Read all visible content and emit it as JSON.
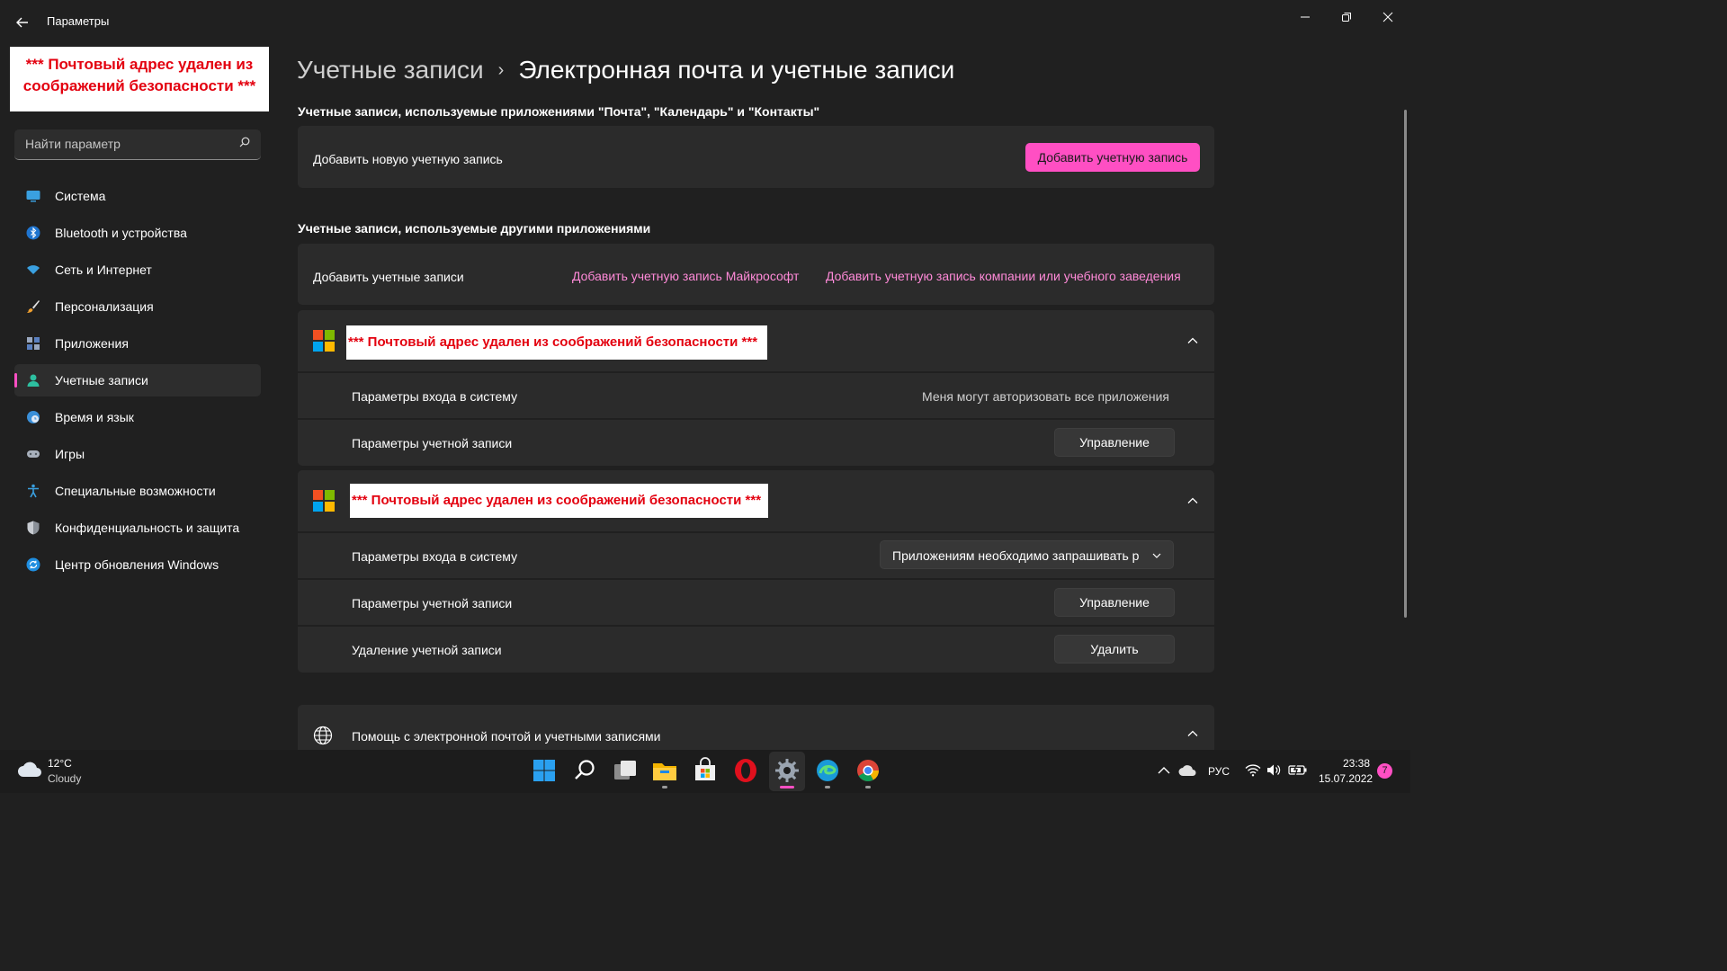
{
  "window": {
    "title": "Параметры"
  },
  "redaction": {
    "sidebar_text": "*** Почтовый адрес удален из соображений безопасности ***",
    "account_text": "*** Почтовый адрес удален из соображений безопасности ***"
  },
  "search": {
    "placeholder": "Найти параметр"
  },
  "sidebar": {
    "items": [
      {
        "label": "Система",
        "icon": "monitor-icon"
      },
      {
        "label": "Bluetooth и устройства",
        "icon": "bluetooth-icon"
      },
      {
        "label": "Сеть и Интернет",
        "icon": "wifi-icon"
      },
      {
        "label": "Персонализация",
        "icon": "brush-icon"
      },
      {
        "label": "Приложения",
        "icon": "apps-icon"
      },
      {
        "label": "Учетные записи",
        "icon": "person-icon",
        "active": true
      },
      {
        "label": "Время и язык",
        "icon": "globe-clock-icon"
      },
      {
        "label": "Игры",
        "icon": "gamepad-icon"
      },
      {
        "label": "Специальные возможности",
        "icon": "accessibility-icon"
      },
      {
        "label": "Конфиденциальность и защита",
        "icon": "shield-icon"
      },
      {
        "label": "Центр обновления Windows",
        "icon": "update-icon"
      }
    ]
  },
  "breadcrumb": {
    "parent": "Учетные записи",
    "separator": "›",
    "current": "Электронная почта и учетные записи"
  },
  "section_mail": {
    "title": "Учетные записи, используемые приложениями \"Почта\", \"Календарь\" и \"Контакты\"",
    "add_row_label": "Добавить новую учетную запись",
    "add_button": "Добавить учетную запись"
  },
  "section_other": {
    "title": "Учетные записи, используемые другими приложениями",
    "add_row_label": "Добавить учетные записи",
    "link_microsoft": "Добавить учетную запись Майкрософт",
    "link_work": "Добавить учетную запись компании или учебного заведения"
  },
  "account1": {
    "signin_label": "Параметры входа в систему",
    "signin_value": "Меня могут авторизовать все приложения",
    "settings_label": "Параметры учетной записи",
    "manage_button": "Управление"
  },
  "account2": {
    "signin_label": "Параметры входа в систему",
    "signin_dropdown": "Приложениям необходимо запрашивать р",
    "settings_label": "Параметры учетной записи",
    "manage_button": "Управление",
    "remove_label": "Удаление учетной записи",
    "remove_button": "Удалить"
  },
  "help": {
    "label": "Помощь с электронной почтой и учетными записями"
  },
  "taskbar": {
    "weather_temp": "12°C",
    "weather_desc": "Cloudy",
    "lang": "РУС",
    "time": "23:38",
    "date": "15.07.2022",
    "notif_count": "7"
  },
  "colors": {
    "accent": "#ff4fc3",
    "link": "#ff8ad8",
    "background": "#202020",
    "card": "#2b2b2b",
    "redaction_text": "#e3000f"
  }
}
